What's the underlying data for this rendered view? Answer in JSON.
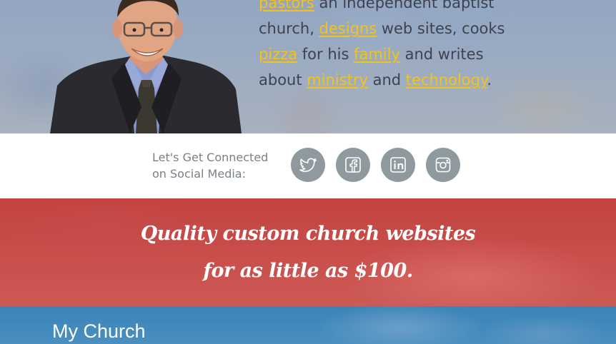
{
  "hero": {
    "text_parts": [
      {
        "text": "pastors",
        "link": true
      },
      {
        "text": " an independent baptist church, ",
        "link": false
      },
      {
        "text": "designs",
        "link": true
      },
      {
        "text": " web sites, cooks ",
        "link": false
      },
      {
        "text": "pizza",
        "link": true
      },
      {
        "text": " for his ",
        "link": false
      },
      {
        "text": "family",
        "link": true
      },
      {
        "text": " and writes about ",
        "link": false
      },
      {
        "text": "ministry",
        "link": true
      },
      {
        "text": " and ",
        "link": false
      },
      {
        "text": "technology",
        "link": true
      },
      {
        "text": ".",
        "link": false
      }
    ],
    "link_color": "#f4c319",
    "text_color": "#3c4250"
  },
  "social": {
    "label_line1": "Let's Get Connected",
    "label_line2": "on Social Media:",
    "icons": [
      "twitter-icon",
      "facebook-icon",
      "linkedin-icon",
      "instagram-icon"
    ],
    "icon_color": "#8f9a9e"
  },
  "promo": {
    "line1": "Quality custom church websites",
    "line2": "for as little as $100.",
    "background": "#c24340"
  },
  "church": {
    "title": "My Church",
    "background": "#3a84b8"
  }
}
